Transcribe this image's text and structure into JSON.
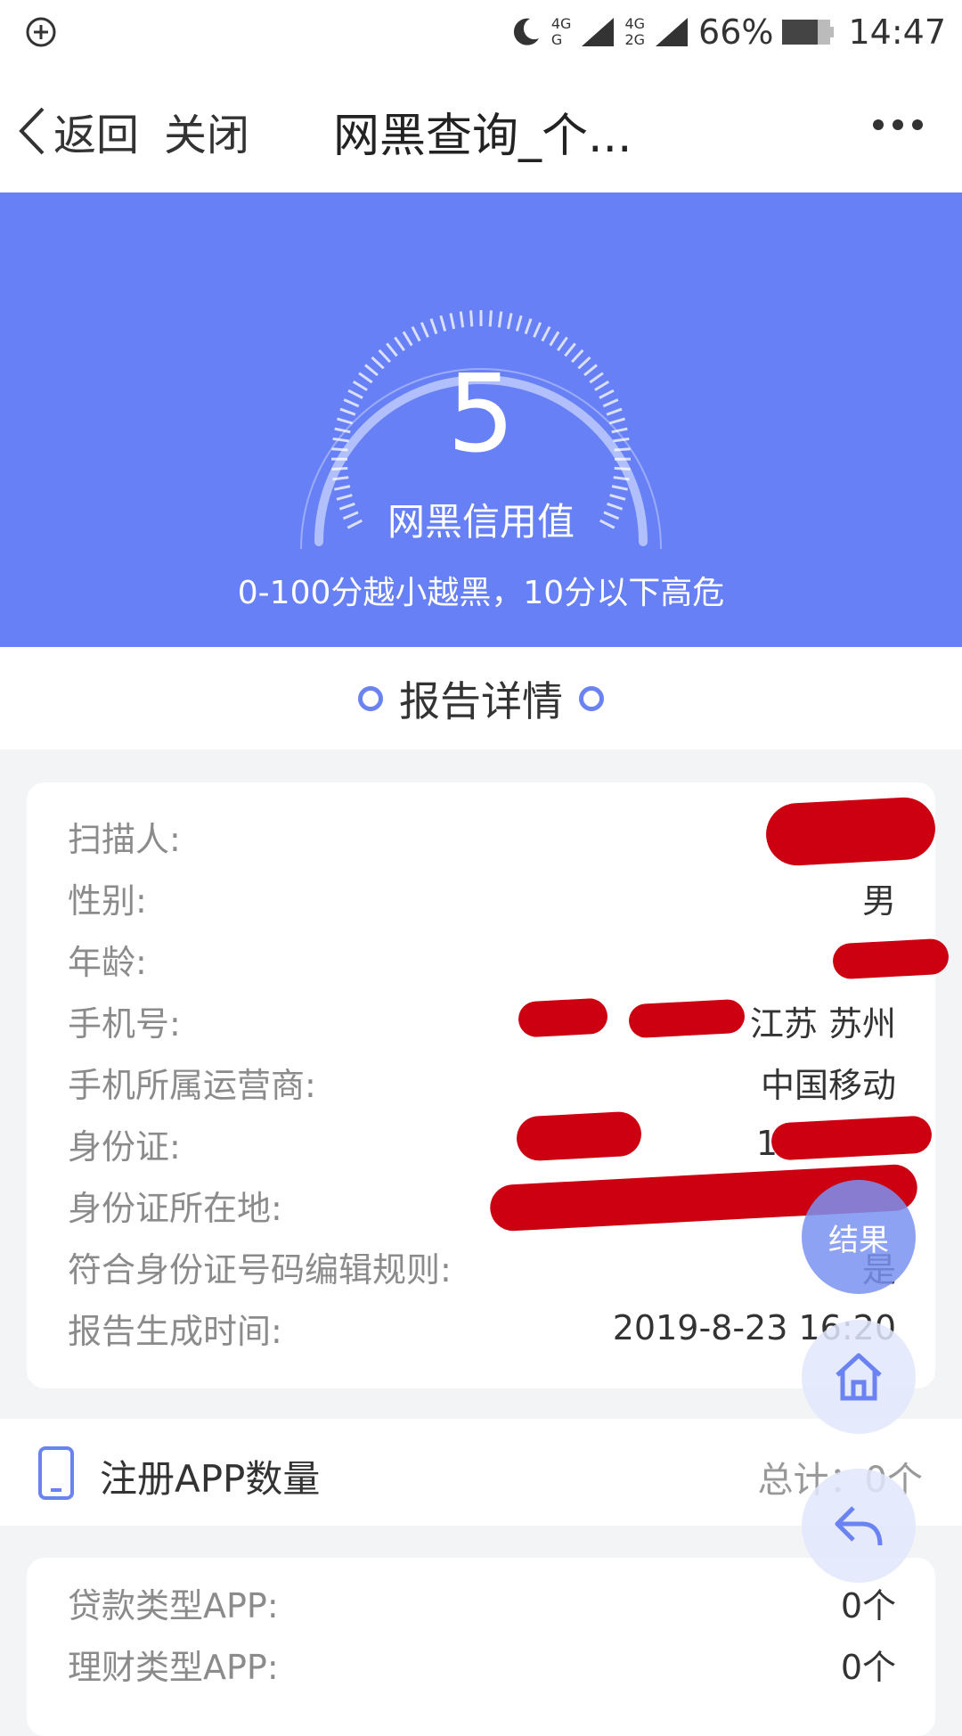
{
  "status_bar": {
    "left_icon": "plus-circle-icon",
    "moon_icon": "moon-icon",
    "network1": "4G",
    "network2": "G",
    "network3": "4G",
    "network4": "2G",
    "battery": "66%",
    "time": "14:47"
  },
  "nav": {
    "back_label": "返回",
    "close_label": "关闭",
    "title": "网黑查询_个...",
    "more_icon": "more-dots-icon"
  },
  "hero": {
    "score": "5",
    "score_label": "网黑信用值",
    "note": "0-100分越小越黑，10分以下高危",
    "background_color": "#6780f5"
  },
  "report": {
    "section_title": "报告详情",
    "rows": [
      {
        "label": "扫描人:",
        "value": ""
      },
      {
        "label": "性别:",
        "value": "男"
      },
      {
        "label": "年龄:",
        "value": ""
      },
      {
        "label": "手机号:",
        "value": "江苏 苏州"
      },
      {
        "label": "手机所属运营商:",
        "value": "中国移动"
      },
      {
        "label": "身份证:",
        "value": "1*******"
      },
      {
        "label": "身份证所在地:",
        "value": ""
      },
      {
        "label": "符合身份证号码编辑规则:",
        "value": "是"
      },
      {
        "label": "报告生成时间:",
        "value": "2019-8-23 16:20"
      }
    ]
  },
  "apps": {
    "title": "注册APP数量",
    "total": "总计：0个",
    "rows": [
      {
        "label": "贷款类型APP:",
        "value": "0个"
      },
      {
        "label": "理财类型APP:",
        "value": "0个"
      }
    ]
  },
  "floating": {
    "result_label": "结果",
    "home_icon": "home-icon",
    "back_icon": "reply-arrow-icon"
  }
}
